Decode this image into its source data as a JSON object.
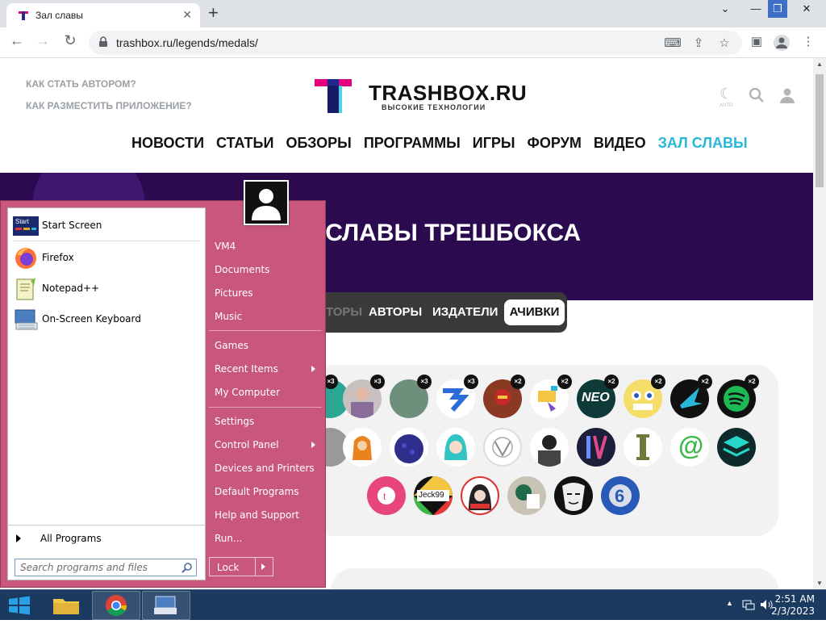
{
  "browser": {
    "tab_title": "Зал славы",
    "url": "trashbox.ru/legends/medals/"
  },
  "site": {
    "top_links": [
      "КАК СТАТЬ АВТОРОМ?",
      "КАК РАЗМЕСТИТЬ ПРИЛОЖЕНИЕ?"
    ],
    "logo_text": "TRASHBOX.RU",
    "logo_sub": "ВЫСОКИЕ ТЕХНОЛОГИИ",
    "theme_label": "AUTO",
    "nav": [
      "НОВОСТИ",
      "СТАТЬИ",
      "ОБЗОРЫ",
      "ПРОГРАММЫ",
      "ИГРЫ",
      "ФОРУМ",
      "ВИДЕО",
      "ЗАЛ СЛАВЫ"
    ],
    "nav_active_index": 7,
    "banner_title": "ЗАЛ СЛАВЫ ТРЕШБОКСА",
    "tabs": {
      "comments": "КОММЕНТАТОРЫ",
      "authors": "АВТОРЫ",
      "publishers": "ИЗДАТЕЛИ",
      "achievements": "АЧИВКИ"
    },
    "row1_multipliers": [
      "×3",
      "×3",
      "×3",
      "×3",
      "×2",
      "×2",
      "×2",
      "×2",
      "×2",
      "×2"
    ],
    "medal_labels": {
      "jeck": "Jeck99",
      "neo": "NEO"
    },
    "colors": {
      "accent": "#29b6d9",
      "banner": "#2b0a4f"
    }
  },
  "startmenu": {
    "pinned": [
      {
        "label": "Start Screen",
        "icon": "start-screen-icon"
      },
      {
        "label": "Firefox",
        "icon": "firefox-icon"
      },
      {
        "label": "Notepad++",
        "icon": "notepad-plus-plus-icon"
      },
      {
        "label": "On-Screen Keyboard",
        "icon": "keyboard-icon"
      }
    ],
    "start_screen_icon_text": "Start",
    "all_programs": "All Programs",
    "search_placeholder": "Search programs and files",
    "right_items": [
      {
        "label": "VM4"
      },
      {
        "label": "Documents"
      },
      {
        "label": "Pictures"
      },
      {
        "label": "Music"
      },
      {
        "label": "Games"
      },
      {
        "label": "Recent Items",
        "submenu": true
      },
      {
        "label": "My Computer"
      },
      {
        "label": "Settings"
      },
      {
        "label": "Control Panel",
        "submenu": true
      },
      {
        "label": "Devices and Printers"
      },
      {
        "label": "Default Programs"
      },
      {
        "label": "Help and Support"
      },
      {
        "label": "Run..."
      }
    ],
    "lock_label": "Lock",
    "colors": {
      "panel": "#c8577b"
    }
  },
  "taskbar": {
    "time": "2:51 AM",
    "date": "2/3/2023",
    "apps": [
      "file-explorer-icon",
      "chrome-icon",
      "on-screen-keyboard-icon"
    ]
  }
}
